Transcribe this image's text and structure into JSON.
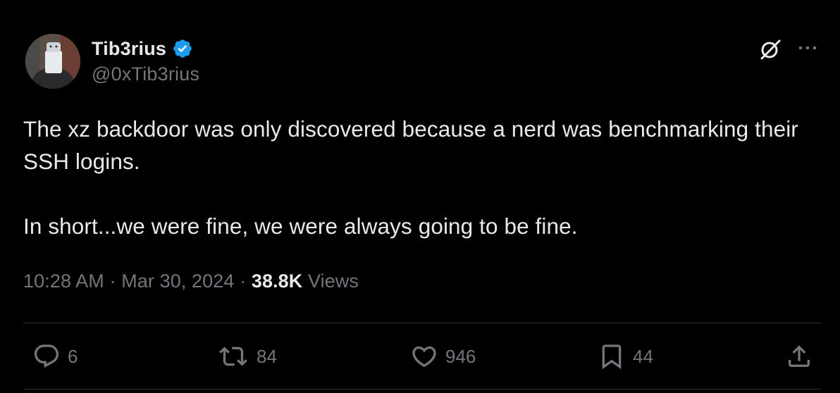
{
  "author": {
    "display_name": "Tib3rius",
    "handle": "@0xTib3rius",
    "verified": true,
    "verified_color": "#1d9bf0"
  },
  "tweet": {
    "paragraphs": [
      "The xz backdoor was only discovered because a nerd was benchmarking their SSH logins.",
      "In short...we were fine, we were always going to be fine."
    ]
  },
  "meta": {
    "time": "10:28 AM",
    "separator": "·",
    "date": "Mar 30, 2024",
    "views_count": "38.8K",
    "views_label": "Views"
  },
  "actions": {
    "replies": "6",
    "reposts": "84",
    "likes": "946",
    "bookmarks": "44"
  },
  "icons": {
    "grok": "grok-icon",
    "more": "more-icon",
    "reply": "reply-icon",
    "repost": "repost-icon",
    "like": "heart-icon",
    "bookmark": "bookmark-icon",
    "share": "share-icon"
  },
  "colors": {
    "background": "#000000",
    "text": "#e7e9ea",
    "secondary": "#71767b",
    "divider": "#2f3336"
  }
}
